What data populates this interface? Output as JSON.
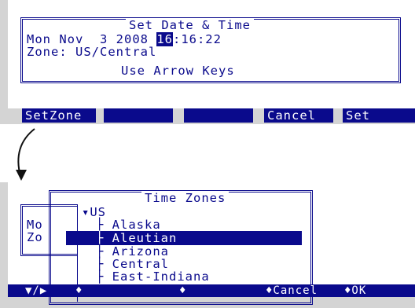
{
  "dialog1": {
    "title": "Set Date & Time",
    "date_prefix": "Mon Nov  3 2008 ",
    "date_day": "16",
    "date_suffix": ":16:22",
    "zone_line": "Zone: US/Central",
    "footer": "Use Arrow Keys"
  },
  "fkeys1": [
    "SetZone",
    "",
    "",
    "Cancel",
    "Set"
  ],
  "dialog2": {
    "bg_mo": "Mo",
    "bg_zo": "Zo",
    "title": "Time Zones",
    "root": "US",
    "items": [
      "Alaska",
      "Aleutian",
      "Arizona",
      "Central",
      "East-Indiana"
    ],
    "selected_index": 1
  },
  "fkeys2": {
    "k1": "▼/▶",
    "k2": "♦",
    "k3": "♦",
    "k4": "♦Cancel",
    "k5": "♦OK"
  },
  "colors": {
    "accent": "#0a0a8c",
    "bezel": "#d4d4d4"
  },
  "icons": {
    "arrow": "curved-down-arrow-icon"
  }
}
